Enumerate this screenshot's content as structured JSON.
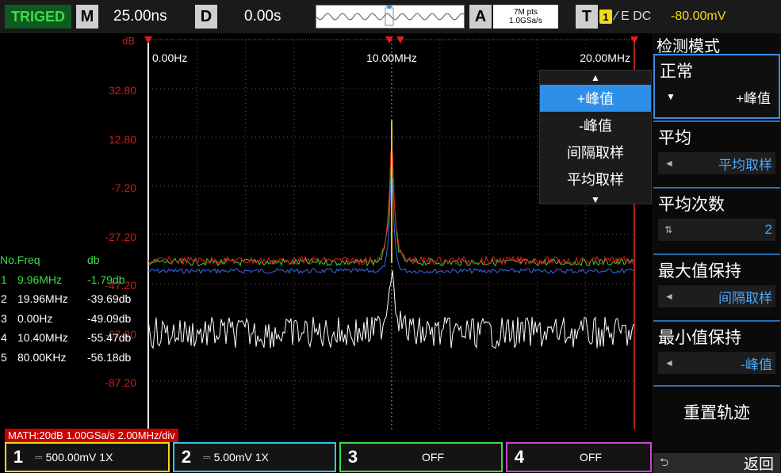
{
  "topbar": {
    "status": "TRIGED",
    "m_letter": "M",
    "timebase": "25.00ns",
    "d_letter": "D",
    "delay": "0.00s",
    "a_letter": "A",
    "memory_depth": "7M pts",
    "sample_rate": "1.0GSa/s",
    "t_letter": "T",
    "trigger_channel": "1",
    "trigger_mode": "∕ E DC",
    "trigger_level": "-80.00mV"
  },
  "plot": {
    "y_unit": "dB",
    "y_ticks": [
      "32.80",
      "12.80",
      "-7.20",
      "-27.20",
      "-47.20",
      "-67.20",
      "-87.20"
    ],
    "x_ticks": [
      "0.00Hz",
      "10.00MHz",
      "20.00MHz"
    ],
    "math_label": "MATH:20dB  1.00GSa/s  2.00MHz/div"
  },
  "peak_table": {
    "headers": [
      "No.Freq",
      "db"
    ],
    "rows": [
      {
        "index": "1",
        "freq": "9.96MHz",
        "db": "-1.79db"
      },
      {
        "index": "2",
        "freq": "19.96MHz",
        "db": "-39.69db"
      },
      {
        "index": "3",
        "freq": "0.00Hz",
        "db": "-49.09db"
      },
      {
        "index": "4",
        "freq": "10.40MHz",
        "db": "-55.47db"
      },
      {
        "index": "5",
        "freq": "80.00KHz",
        "db": "-56.18db"
      }
    ]
  },
  "channels": [
    {
      "num": "1",
      "setting": "500.00mV  1X",
      "color": "#f5d916"
    },
    {
      "num": "2",
      "setting": "5.00mV  1X",
      "color": "#35c6e8"
    },
    {
      "num": "3",
      "setting": "OFF",
      "color": "#3ddc4a"
    },
    {
      "num": "4",
      "setting": "OFF",
      "color": "#d040d8"
    }
  ],
  "menu": {
    "title": "检测模式",
    "sections": [
      {
        "label": "正常",
        "value": "+峰值",
        "arrow": "▼"
      },
      {
        "label": "平均",
        "value": "平均取样",
        "arrow": "◄"
      },
      {
        "label": "平均次数",
        "value": "2",
        "arrow": "⇅"
      },
      {
        "label": "最大值保持",
        "value": "间隔取样",
        "arrow": "◄"
      },
      {
        "label": "最小值保持",
        "value": "-峰值",
        "arrow": "◄"
      }
    ],
    "reset_label": "重置轨迹",
    "back_icon": "⮌",
    "back_label": "返回"
  },
  "dropdown": {
    "up_arrow": "▲",
    "down_arrow": "▼",
    "items": [
      "+峰值",
      "-峰值",
      "间隔取样",
      "平均取样"
    ],
    "selected_index": 0
  },
  "colors": {
    "trace_red": "#e51b1b",
    "trace_green": "#37d13b",
    "trace_blue": "#3569e8",
    "trace_white": "#ffffff",
    "marker": "#e51b1b",
    "accent": "#2e8fe8"
  }
}
